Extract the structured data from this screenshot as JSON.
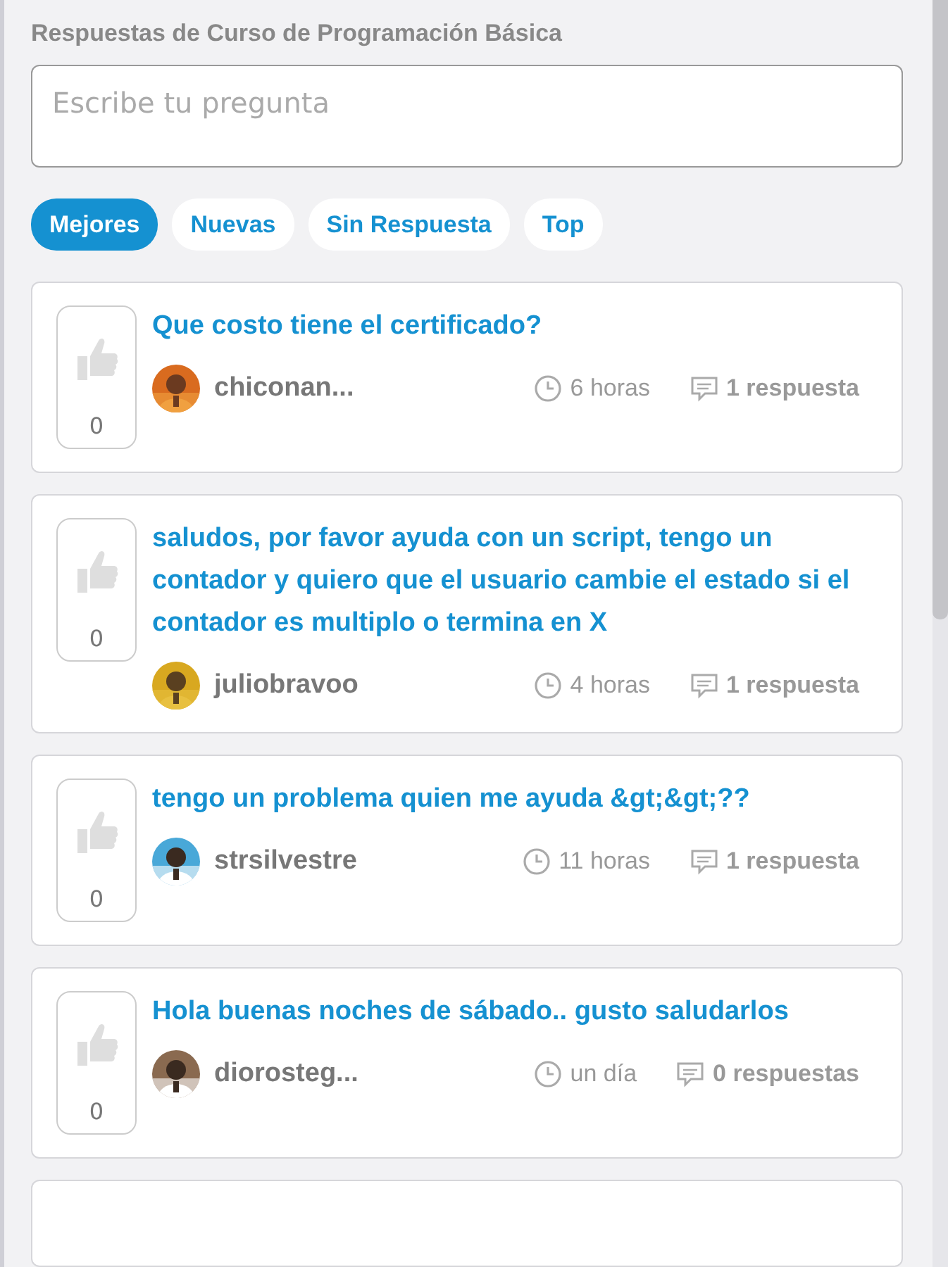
{
  "header": {
    "title": "Respuestas de Curso de Programación Básica"
  },
  "question_field": {
    "placeholder": "Escribe tu pregunta"
  },
  "filters": [
    {
      "label": "Mejores",
      "selected": true
    },
    {
      "label": "Nuevas",
      "selected": false
    },
    {
      "label": "Sin Respuesta",
      "selected": false
    },
    {
      "label": "Top",
      "selected": false
    }
  ],
  "questions": [
    {
      "votes": "0",
      "title": "Que costo tiene el certificado?",
      "author": "chiconan...",
      "time": "6 horas",
      "answers": "1 respuesta"
    },
    {
      "votes": "0",
      "title": "saludos, por favor ayuda con un script, tengo un contador y quiero que el usuario cambie el estado si el contador es multiplo o termina en X",
      "author": "juliobravoo",
      "time": "4 horas",
      "answers": "1 respuesta"
    },
    {
      "votes": "0",
      "title": "tengo un problema quien me ayuda &gt;&gt;??",
      "author": "strsilvestre",
      "time": "11 horas",
      "answers": "1 respuesta"
    },
    {
      "votes": "0",
      "title": "Hola buenas noches de sábado.. gusto saludarlos",
      "author": "diorosteg...",
      "time": "un día",
      "answers": "0 respuestas"
    }
  ]
}
